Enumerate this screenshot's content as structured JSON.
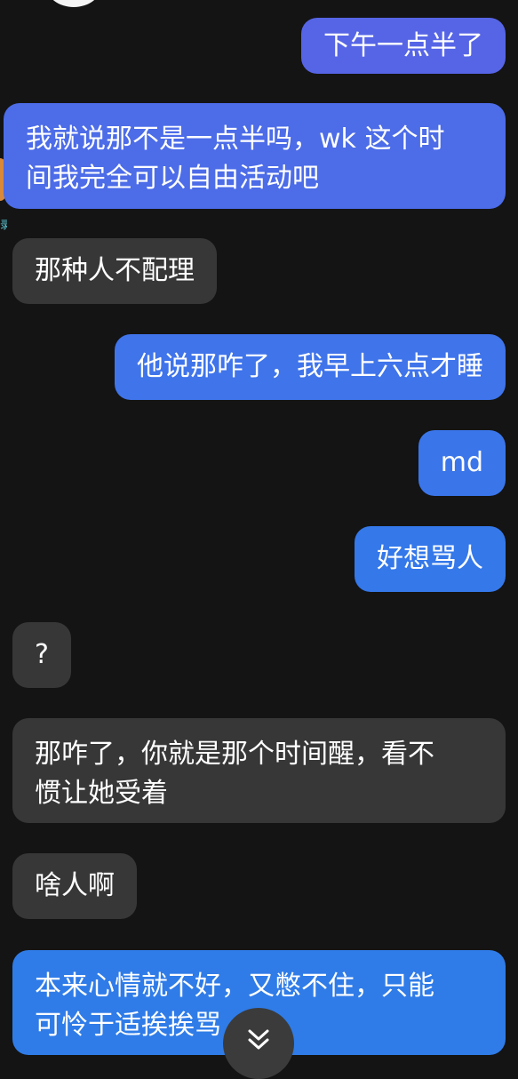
{
  "conversation": {
    "messages": [
      {
        "id": "m1",
        "side": "sent",
        "lines": [
          "下午一点半了"
        ],
        "color": "#5665e6"
      },
      {
        "id": "m2",
        "side": "sent",
        "lines": [
          "我就说那不是一点半吗，wk 这个时",
          "间我完全可以自由活动吧"
        ],
        "color": "#4c6ce8"
      },
      {
        "id": "m3",
        "side": "received",
        "lines": [
          "那种人不配理"
        ]
      },
      {
        "id": "m4",
        "side": "sent",
        "lines": [
          "他说那咋了，我早上六点才睡"
        ],
        "color": "#3f74ea"
      },
      {
        "id": "m5",
        "side": "sent",
        "lines": [
          "md"
        ],
        "color": "#3a76ea"
      },
      {
        "id": "m6",
        "side": "sent",
        "lines": [
          "好想骂人"
        ],
        "color": "#3478ea"
      },
      {
        "id": "m7",
        "side": "received",
        "lines": [
          "?"
        ]
      },
      {
        "id": "m8",
        "side": "received",
        "lines": [
          "那咋了，你就是那个时间醒，看不",
          "惯让她受着"
        ]
      },
      {
        "id": "m9",
        "side": "received",
        "lines": [
          "啥人啊"
        ]
      },
      {
        "id": "m10",
        "side": "sent",
        "lines": [
          "本来心情就不好，又憋不住，只能",
          "可怜于适挨挨骂"
        ],
        "color": "#2f7ce8"
      }
    ]
  },
  "edge_glyph": "录",
  "scroll_button": {
    "icon": "double-chevron-down-icon"
  }
}
